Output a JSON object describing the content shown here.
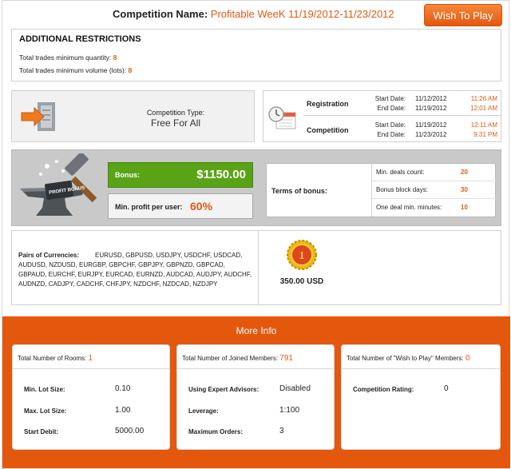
{
  "header": {
    "title_label": "Competition Name:",
    "title_value": "Profitable WeeK 11/19/2012-11/23/2012",
    "wish_button": "Wish To Play"
  },
  "restrictions": {
    "heading": "ADDITIONAL RESTRICTIONS",
    "qty_label": "Total trades minimum quantity:",
    "qty_value": "8",
    "vol_label": "Total trades minimum volume (lots):",
    "vol_value": "8"
  },
  "competition_type": {
    "label": "Competition Type:",
    "value": "Free For All",
    "icon": "arrow-into-document-icon"
  },
  "schedule": {
    "icon": "clock-calendar-icon",
    "registration": {
      "label": "Registration",
      "start_label": "Start Date:",
      "start_date": "11/12/2012",
      "start_time": "11:26 AM",
      "end_label": "End Date:",
      "end_date": "11/19/2012",
      "end_time": "12:01 AM"
    },
    "competition": {
      "label": "Competition",
      "start_label": "Start Date:",
      "start_date": "11/19/2012",
      "start_time": "12:11 AM",
      "end_label": "End Date:",
      "end_date": "11/23/2012",
      "end_time": "9:31 PM"
    }
  },
  "bonus": {
    "icon_text": "PROFIT BONUS",
    "bonus_label": "Bonus:",
    "bonus_value": "$1150.00",
    "min_profit_label": "Min. profit per user:",
    "min_profit_value": "60%",
    "terms_label": "Terms of bonus:",
    "terms": [
      {
        "label": "Min. deals count:",
        "value": "20"
      },
      {
        "label": "Bonus block days:",
        "value": "30"
      },
      {
        "label": "One deal min. minutes:",
        "value": "10"
      }
    ]
  },
  "pairs": {
    "label": "Pairs of Currencies:",
    "value": "EURUSD, GBPUSD, USDJPY, USDCHF, USDCAD, AUDUSD, NZDUSD, EURGBP, GBPCHF, GBPJPY, GBPNZD, GBPCAD, GBPAUD, EURCHF, EURJPY, EURCAD, EURNZD, AUDCAD, AUDJPY, AUDCHF, AUDNZD, CADJPY, CADCHF, CHFJPY, NZDCHF, NZDCAD, NZDJPY",
    "prize": "350.00 USD",
    "medal_text": "1"
  },
  "more_info": {
    "heading": "More Info",
    "rooms": {
      "label": "Total Number of Rooms:",
      "value": "1",
      "items": [
        {
          "label": "Min. Lot Size:",
          "value": "0.10"
        },
        {
          "label": "Max. Lot Size:",
          "value": "1.00"
        },
        {
          "label": "Start Debit:",
          "value": "5000.00"
        }
      ]
    },
    "members": {
      "label": "Total Number of Joined Members:",
      "value": "791",
      "items": [
        {
          "label": "Using Expert Advisors:",
          "value": "Disabled"
        },
        {
          "label": "Leverage:",
          "value": "1:100"
        },
        {
          "label": "Maximum Orders:",
          "value": "3"
        }
      ]
    },
    "wish": {
      "label": "Total Number of \"Wish to Play\" Members:",
      "value": "0",
      "items": [
        {
          "label": "Competition Rating:",
          "value": "0"
        }
      ]
    }
  }
}
